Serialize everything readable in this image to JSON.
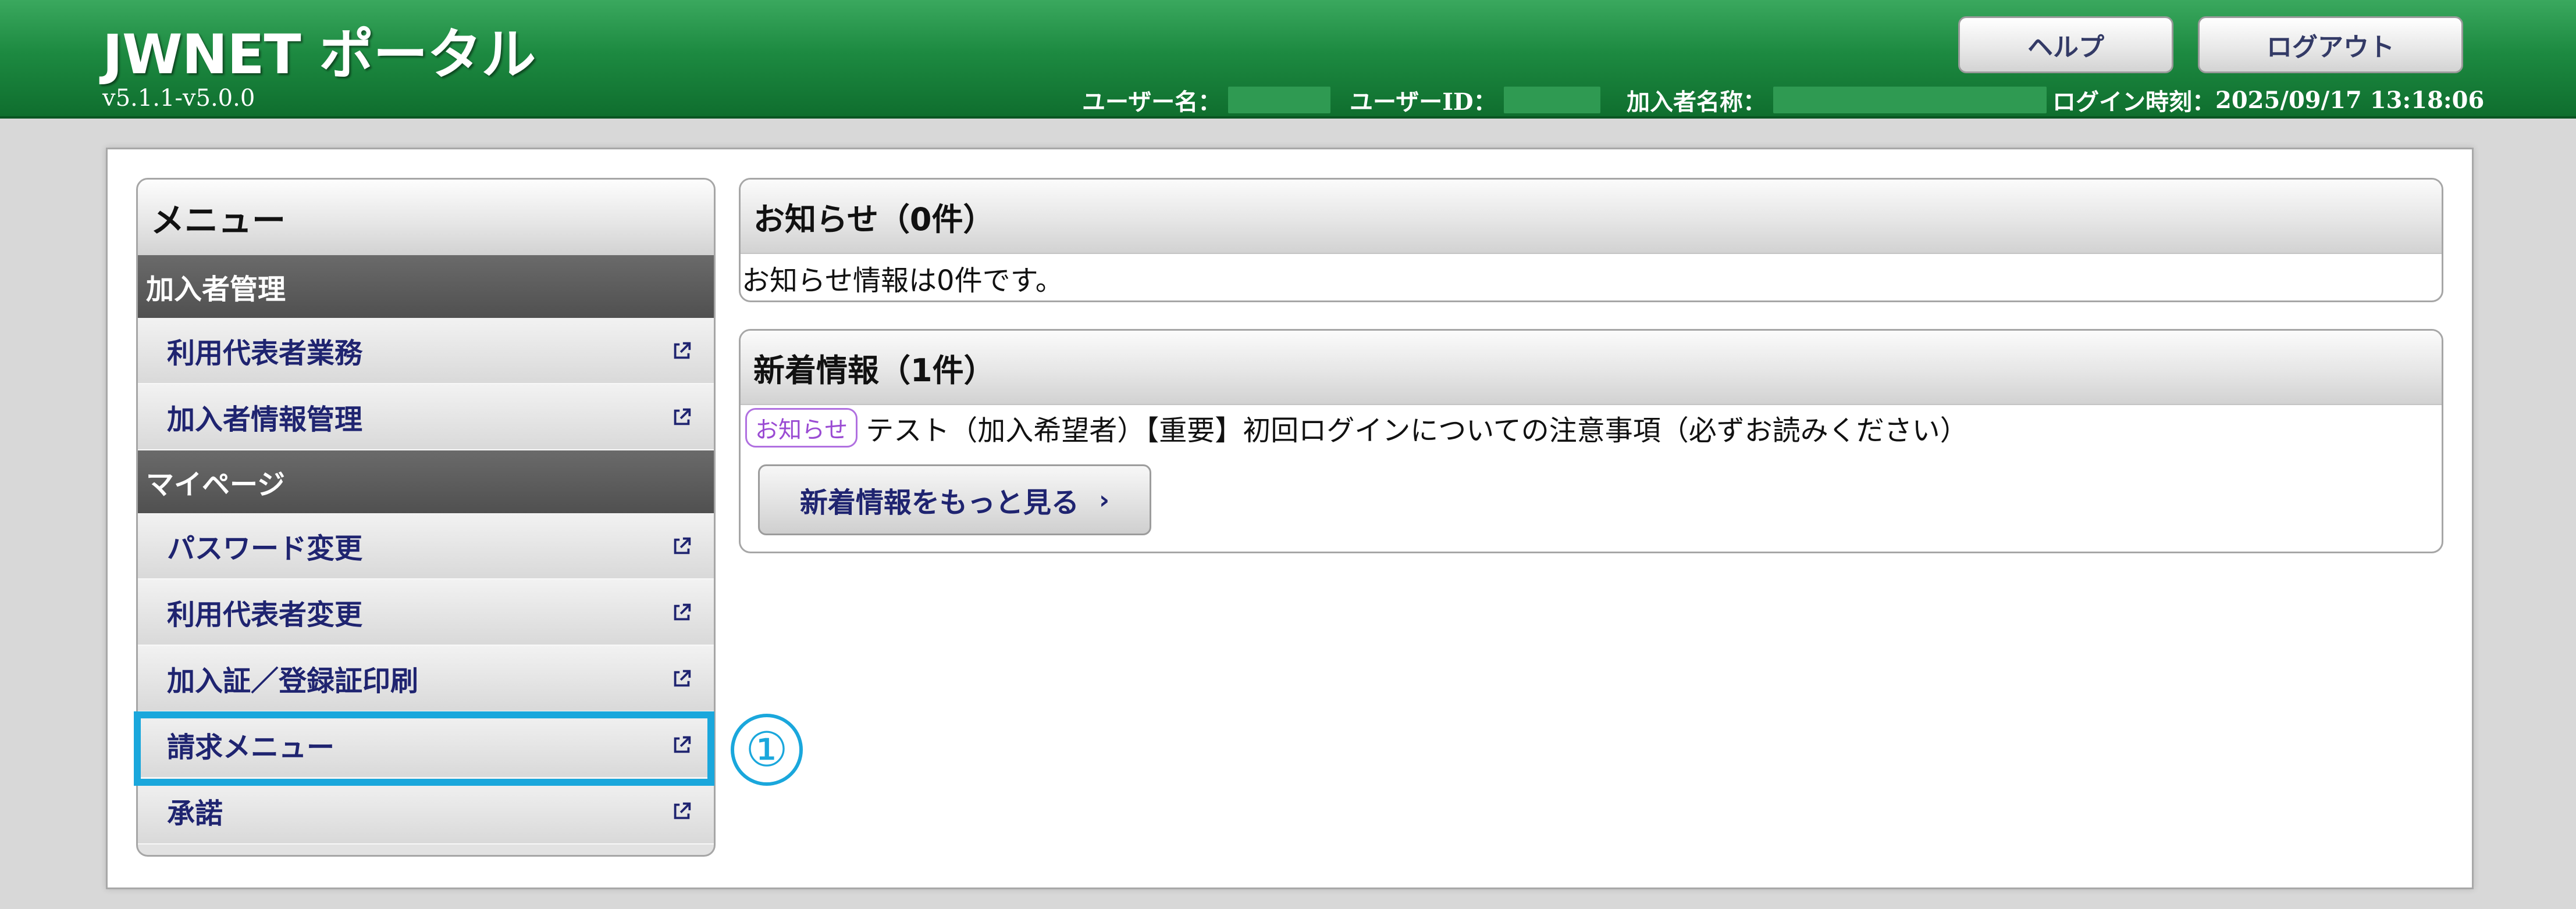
{
  "header": {
    "app_title": "JWNET ポータル",
    "version": "v5.1.1-v5.0.0",
    "help_label": "ヘルプ",
    "logout_label": "ログアウト",
    "user_name_label": "ユーザー名：",
    "user_id_label": "ユーザーID：",
    "member_name_label": "加入者名称：",
    "login_time_label": "ログイン時刻：",
    "login_time_value": "2025/09/17 13:18:06"
  },
  "menu": {
    "title": "メニュー",
    "sections": [
      {
        "label": "加入者管理",
        "items": [
          {
            "label": "利用代表者業務"
          },
          {
            "label": "加入者情報管理"
          }
        ]
      },
      {
        "label": "マイページ",
        "items": [
          {
            "label": "パスワード変更"
          },
          {
            "label": "利用代表者変更"
          },
          {
            "label": "加入証／登録証印刷"
          },
          {
            "label": "請求メニュー"
          },
          {
            "label": "承諾"
          }
        ]
      }
    ]
  },
  "callout": {
    "label": "①"
  },
  "notices": {
    "title": "お知らせ（0件）",
    "message": "お知らせ情報は0件です。"
  },
  "news": {
    "title": "新着情報（1件）",
    "items": [
      {
        "tag": "お知らせ",
        "text": "テスト（加入希望者）【重要】初回ログインについての注意事項（必ずお読みください）"
      }
    ],
    "more_label": "新着情報をもっと見る",
    "more_chevron": "›"
  },
  "colors": {
    "header_green": "#1d8a41",
    "menu_text": "#1f2470",
    "highlight": "#1aa7dc",
    "tag_purple": "#9a4bd3"
  },
  "icons": {
    "external_link": "external-link-icon"
  }
}
